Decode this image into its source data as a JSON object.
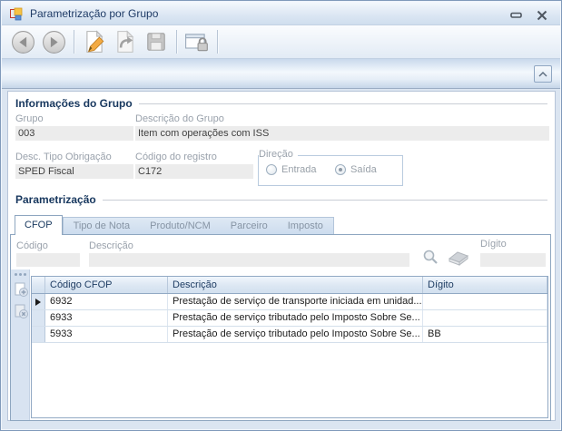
{
  "window": {
    "title": "Parametrização por Grupo"
  },
  "colors": {
    "accent_navy": "#17375e",
    "titlebar_text": "#1f3b66",
    "disabled_label": "#9aa2ac",
    "readonly_field_bg": "#ececec",
    "grid_header_text": "#1f3d63",
    "edit_pencil_orange": "#f3ab44"
  },
  "toolbar": {
    "buttons": [
      {
        "name": "back",
        "icon": "arrow-left-circle-icon",
        "enabled": false
      },
      {
        "name": "forward",
        "icon": "arrow-right-circle-icon",
        "enabled": false
      },
      {
        "name": "edit",
        "icon": "pencil-document-icon",
        "enabled": true
      },
      {
        "name": "undo",
        "icon": "undo-document-icon",
        "enabled": false
      },
      {
        "name": "save",
        "icon": "floppy-disk-icon",
        "enabled": false
      },
      {
        "name": "security",
        "icon": "window-lock-icon",
        "enabled": true
      }
    ]
  },
  "collapse_panel": {
    "icon": "chevron-up-icon"
  },
  "group_info": {
    "section_title": "Informações do Grupo",
    "grupo": {
      "label": "Grupo",
      "value": "003"
    },
    "descricao_grupo": {
      "label": "Descrição do Grupo",
      "value": "Item com operações com ISS"
    },
    "tipo_obrigacao": {
      "label": "Desc. Tipo Obrigação",
      "value": "SPED Fiscal"
    },
    "codigo_registro": {
      "label": "Código do registro",
      "value": "C172"
    },
    "direcao": {
      "label": "Direção",
      "options": [
        {
          "label": "Entrada",
          "selected": false
        },
        {
          "label": "Saída",
          "selected": true
        }
      ]
    }
  },
  "parametrizacao": {
    "section_title": "Parametrização",
    "tabs": [
      {
        "label": "CFOP",
        "active": true
      },
      {
        "label": "Tipo de Nota",
        "active": false
      },
      {
        "label": "Produto/NCM",
        "active": false
      },
      {
        "label": "Parceiro",
        "active": false
      },
      {
        "label": "Imposto",
        "active": false
      }
    ],
    "filters": {
      "codigo": {
        "label": "Código",
        "value": ""
      },
      "descricao": {
        "label": "Descrição",
        "value": ""
      },
      "digito": {
        "label": "Dígito",
        "value": ""
      },
      "icons": [
        "search-icon",
        "eraser-icon"
      ]
    },
    "grid": {
      "columns": [
        "Código CFOP",
        "Descrição",
        "Dígito"
      ],
      "rows": [
        {
          "codigo": "6932",
          "descricao": "Prestação de serviço de transporte iniciada em unidad...",
          "digito": "",
          "current": true
        },
        {
          "codigo": "6933",
          "descricao": "Prestação de serviço tributado pelo Imposto Sobre Se...",
          "digito": "",
          "current": false
        },
        {
          "codigo": "5933",
          "descricao": "Prestação de serviço tributado pelo Imposto Sobre Se...",
          "digito": "BB",
          "current": false
        }
      ],
      "side_buttons": [
        "add-row-icon",
        "delete-row-icon"
      ]
    }
  }
}
